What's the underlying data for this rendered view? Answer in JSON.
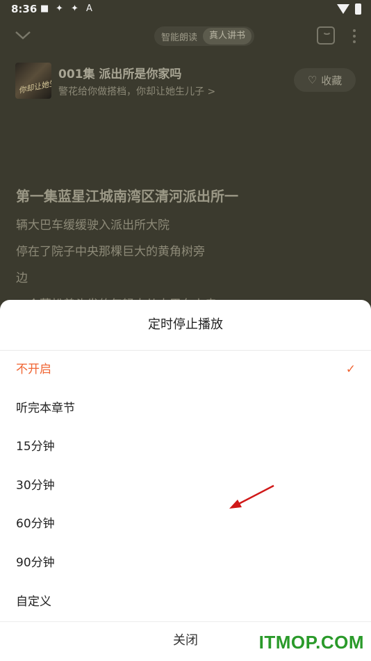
{
  "status_bar": {
    "time": "8:36",
    "icons": [
      "square-icon",
      "aperture-icon",
      "aperture-icon",
      "a-icon",
      "wifi-icon",
      "battery-charging-icon"
    ]
  },
  "header": {
    "mode_tabs": [
      "智能朗读",
      "真人讲书"
    ],
    "selected_mode": "真人讲书"
  },
  "book": {
    "episode_title": "001集 派出所是你家吗",
    "subtitle": "警花给你做搭档，你却让她生儿子 >",
    "cover_text": "你却让她生儿子",
    "collect_label": "收藏"
  },
  "content": {
    "lead": "第一集蓝星江城南湾区清河派出所一",
    "lines": [
      "辆大巴车缓缓驶入派出所大院",
      "停在了院子中央那棵巨大的黄角树旁",
      "边",
      "一个蓬松着头发的年轻人从大巴车上走"
    ]
  },
  "sheet": {
    "title": "定时停止播放",
    "options": [
      "不开启",
      "听完本章节",
      "15分钟",
      "30分钟",
      "60分钟",
      "90分钟",
      "自定义"
    ],
    "selected_option": "不开启",
    "close_label": "关闭"
  },
  "colors": {
    "accent": "#f06432",
    "overlay_bg": "#3b3a2e",
    "watermark": "#2a9a2a"
  },
  "watermark": "ITMOP.COM"
}
